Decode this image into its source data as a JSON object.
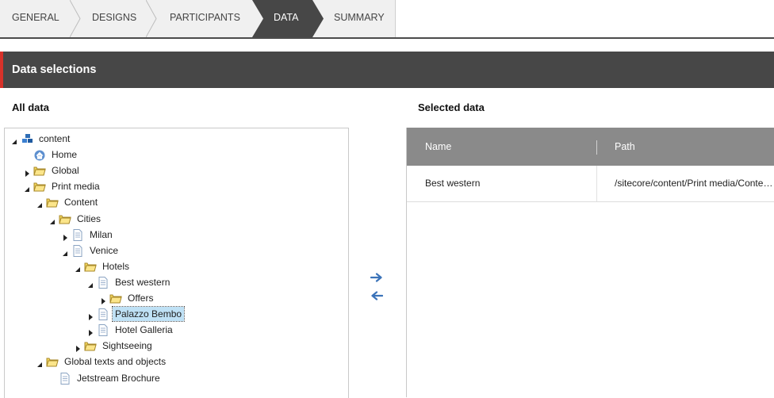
{
  "wizard": {
    "steps": [
      "GENERAL",
      "DESIGNS",
      "PARTICIPANTS",
      "DATA",
      "SUMMARY"
    ],
    "active": "DATA"
  },
  "header": {
    "title": "Data selections"
  },
  "all_data": {
    "title": "All data",
    "tree": [
      {
        "label": "content",
        "icon": "database-icon",
        "toggle": "expanded"
      },
      {
        "label": "Home",
        "icon": "home-icon",
        "toggle": "none"
      },
      {
        "label": "Global",
        "icon": "folder-icon",
        "toggle": "collapsed"
      },
      {
        "label": "Print media",
        "icon": "folder-icon",
        "toggle": "expanded"
      },
      {
        "label": "Content",
        "icon": "folder-icon",
        "toggle": "expanded"
      },
      {
        "label": "Cities",
        "icon": "folder-icon",
        "toggle": "expanded"
      },
      {
        "label": "Milan",
        "icon": "document-icon",
        "toggle": "collapsed"
      },
      {
        "label": "Venice",
        "icon": "document-icon",
        "toggle": "expanded"
      },
      {
        "label": "Hotels",
        "icon": "folder-icon",
        "toggle": "expanded"
      },
      {
        "label": "Best western",
        "icon": "document-icon",
        "toggle": "expanded"
      },
      {
        "label": "Offers",
        "icon": "folder-icon",
        "toggle": "collapsed"
      },
      {
        "label": "Palazzo Bembo",
        "icon": "document-icon",
        "toggle": "collapsed",
        "selected": true
      },
      {
        "label": "Hotel Galleria",
        "icon": "document-icon",
        "toggle": "collapsed"
      },
      {
        "label": "Sightseeing",
        "icon": "folder-icon",
        "toggle": "collapsed"
      },
      {
        "label": "Global texts and objects",
        "icon": "folder-icon",
        "toggle": "expanded"
      },
      {
        "label": "Jetstream Brochure",
        "icon": "document-icon",
        "toggle": "none"
      }
    ]
  },
  "selected_data": {
    "title": "Selected data",
    "columns": [
      "Name",
      "Path"
    ],
    "rows": [
      [
        "Best western",
        "/sitecore/content/Print media/Content/Cities/Venice/Hotels/Best western"
      ]
    ]
  },
  "colors": {
    "accent": "#d8322a",
    "header_band": "#474747",
    "active_step": "#474747",
    "grid_header": "#8a8a8a",
    "arrow": "#3b73b9"
  }
}
